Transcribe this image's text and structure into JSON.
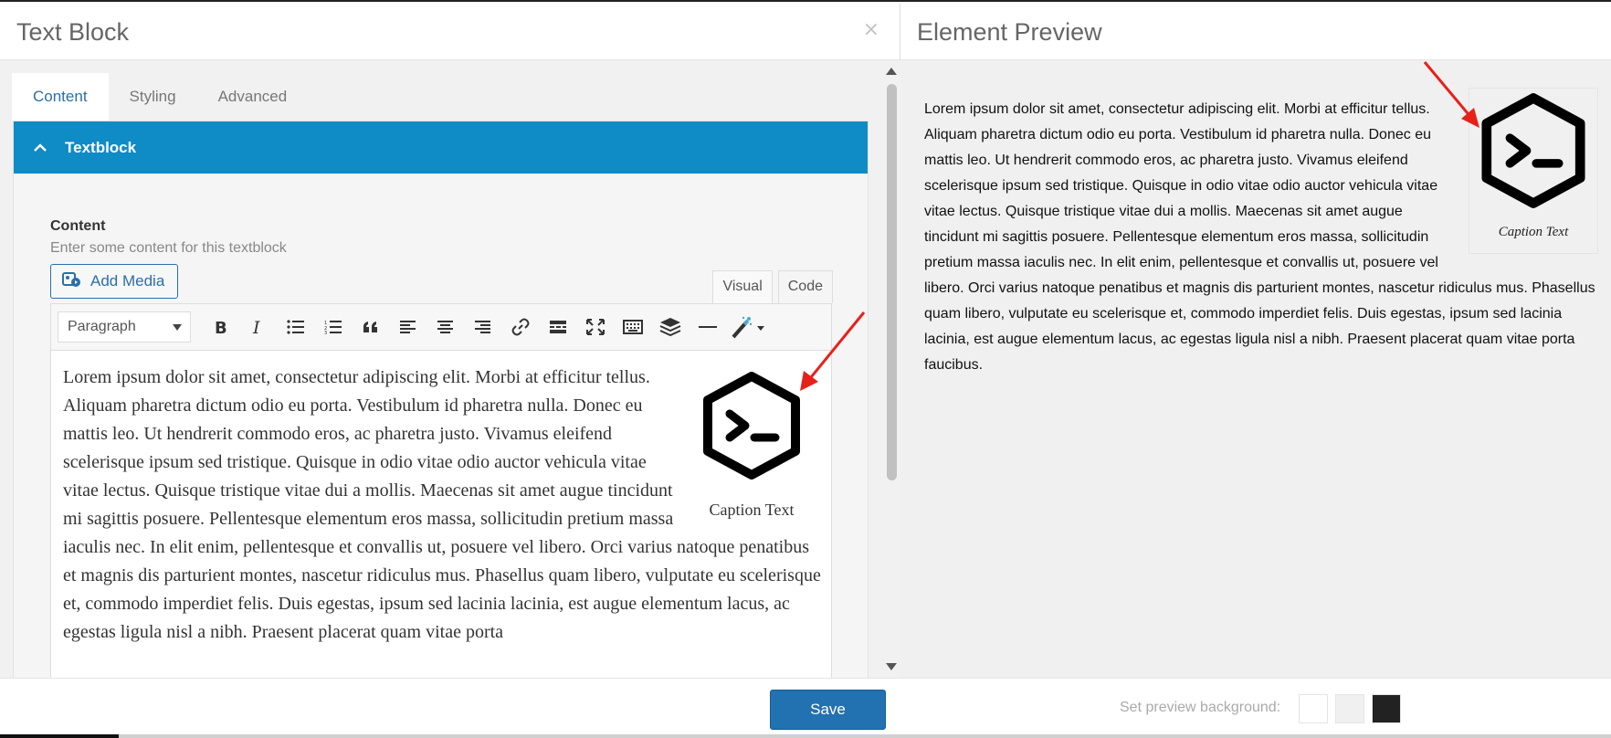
{
  "left_panel": {
    "title": "Text Block",
    "close_icon": "×",
    "tabs": [
      {
        "label": "Content",
        "active": true
      },
      {
        "label": "Styling",
        "active": false
      },
      {
        "label": "Advanced",
        "active": false
      }
    ],
    "section": {
      "title": "Textblock",
      "field_label": "Content",
      "field_description": "Enter some content for this textblock",
      "add_media_label": "Add Media",
      "mode_tabs": [
        {
          "label": "Visual",
          "active": true
        },
        {
          "label": "Code",
          "active": false
        }
      ],
      "format_select": "Paragraph",
      "toolbar_buttons": [
        "bold-icon",
        "italic-icon",
        "bullet-list-icon",
        "numbered-list-icon",
        "blockquote-icon",
        "align-left-icon",
        "align-center-icon",
        "align-right-icon",
        "link-icon",
        "read-more-icon",
        "fullscreen-icon",
        "keyboard-icon",
        "layers-icon",
        "horizontal-line-icon",
        "magic-wand-icon"
      ],
      "editor_text": "Lorem ipsum dolor sit amet, consectetur adipiscing elit. Morbi at efficitur tellus. Aliquam pharetra dictum odio eu porta. Vestibulum id pharetra nulla. Donec eu mattis leo. Ut hendrerit commodo eros, ac pharetra justo. Vivamus eleifend scelerisque ipsum sed tristique. Quisque in odio vitae odio auctor vehicula vitae vitae lectus. Quisque tristique vitae dui a mollis. Maecenas sit amet augue tincidunt mi sagittis posuere. Pellentesque elementum eros massa, sollicitudin pretium massa iaculis nec. In elit enim, pellentesque et convallis ut, posuere vel libero. Orci varius natoque penatibus et magnis dis parturient montes, nascetur ridiculus mus. Phasellus quam libero, vulputate eu scelerisque et, commodo imperdiet felis. Duis egestas, ipsum sed lacinia lacinia, est augue elementum lacus, ac egestas ligula nisl a nibh. Praesent placerat quam vitae porta",
      "image_caption": "Caption Text"
    },
    "save_label": "Save"
  },
  "right_panel": {
    "title": "Element Preview",
    "preview_text": "Lorem ipsum dolor sit amet, consectetur adipiscing elit. Morbi at efficitur tellus. Aliquam pharetra dictum odio eu porta. Vestibulum id pharetra nulla. Donec eu mattis leo. Ut hendrerit commodo eros, ac pharetra justo. Vivamus eleifend scelerisque ipsum sed tristique. Quisque in odio vitae odio auctor vehicula vitae vitae lectus. Quisque tristique vitae dui a mollis. Maecenas sit amet augue tincidunt mi sagittis posuere. Pellentesque elementum eros massa, sollicitudin pretium massa iaculis nec. In elit enim, pellentesque et convallis ut, posuere vel libero. Orci varius natoque penatibus et magnis dis parturient montes, nascetur ridiculus mus. Phasellus quam libero, vulputate eu scelerisque et, commodo imperdiet felis. Duis egestas, ipsum sed lacinia lacinia, est augue elementum lacus, ac egestas ligula nisl a nibh. Praesent placerat quam vitae porta faucibus.",
    "image_caption": "Caption Text",
    "background_label": "Set preview background:",
    "background_swatches": [
      "#ffffff",
      "#f0f0f0",
      "#222222"
    ]
  },
  "colors": {
    "accent_bar": "#0f8bc6",
    "save_button": "#2271b1",
    "annotation_arrow": "#e8201a"
  }
}
